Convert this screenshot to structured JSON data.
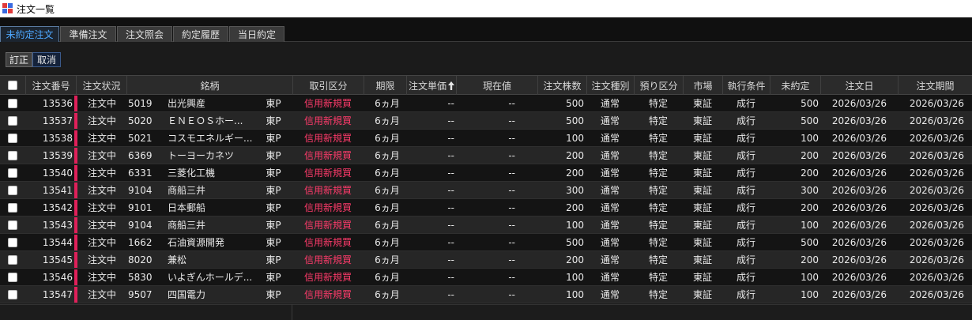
{
  "window": {
    "title": "注文一覧"
  },
  "tabs": [
    {
      "label": "未約定注文",
      "active": true
    },
    {
      "label": "準備注文",
      "active": false
    },
    {
      "label": "注文照会",
      "active": false
    },
    {
      "label": "約定履歴",
      "active": false
    },
    {
      "label": "当日約定",
      "active": false
    }
  ],
  "toolbar": {
    "edit_label": "訂正",
    "cancel_label": "取消"
  },
  "colors": {
    "accent": "#4ea8ff",
    "status_bar": "#e0205a",
    "trade_type": "#ff3b6b"
  },
  "table": {
    "headers": {
      "order_no": "注文番号",
      "status": "注文状況",
      "issue": "銘柄",
      "trade_type": "取引区分",
      "term": "期限",
      "unit_price": "注文単価",
      "unit_price_sort_icon": "sort-up-arrow-icon",
      "current_price": "現在値",
      "qty": "注文株数",
      "order_kind": "注文種別",
      "account": "預り区分",
      "market": "市場",
      "exec_cond": "執行条件",
      "unfilled": "未約定",
      "order_date": "注文日",
      "expiry": "注文期間"
    },
    "rows": [
      {
        "order_no": "13536",
        "status": "注文中",
        "code": "5019",
        "name": "出光興産",
        "exch": "東P",
        "trade_type": "信用新規買",
        "term": "6ヵ月",
        "unit_price": "--",
        "current_price": "--",
        "qty": "500",
        "order_kind": "通常",
        "account": "特定",
        "market": "東証",
        "exec_cond": "成行",
        "unfilled": "500",
        "order_date": "2026/03/26",
        "expiry": "2026/03/26"
      },
      {
        "order_no": "13537",
        "status": "注文中",
        "code": "5020",
        "name": "ＥＮＥＯＳホー...",
        "exch": "東P",
        "trade_type": "信用新規買",
        "term": "6ヵ月",
        "unit_price": "--",
        "current_price": "--",
        "qty": "500",
        "order_kind": "通常",
        "account": "特定",
        "market": "東証",
        "exec_cond": "成行",
        "unfilled": "500",
        "order_date": "2026/03/26",
        "expiry": "2026/03/26"
      },
      {
        "order_no": "13538",
        "status": "注文中",
        "code": "5021",
        "name": "コスモエネルギー...",
        "exch": "東P",
        "trade_type": "信用新規買",
        "term": "6ヵ月",
        "unit_price": "--",
        "current_price": "--",
        "qty": "100",
        "order_kind": "通常",
        "account": "特定",
        "market": "東証",
        "exec_cond": "成行",
        "unfilled": "100",
        "order_date": "2026/03/26",
        "expiry": "2026/03/26"
      },
      {
        "order_no": "13539",
        "status": "注文中",
        "code": "6369",
        "name": "トーヨーカネツ",
        "exch": "東P",
        "trade_type": "信用新規買",
        "term": "6ヵ月",
        "unit_price": "--",
        "current_price": "--",
        "qty": "200",
        "order_kind": "通常",
        "account": "特定",
        "market": "東証",
        "exec_cond": "成行",
        "unfilled": "200",
        "order_date": "2026/03/26",
        "expiry": "2026/03/26"
      },
      {
        "order_no": "13540",
        "status": "注文中",
        "code": "6331",
        "name": "三菱化工機",
        "exch": "東P",
        "trade_type": "信用新規買",
        "term": "6ヵ月",
        "unit_price": "--",
        "current_price": "--",
        "qty": "200",
        "order_kind": "通常",
        "account": "特定",
        "market": "東証",
        "exec_cond": "成行",
        "unfilled": "200",
        "order_date": "2026/03/26",
        "expiry": "2026/03/26"
      },
      {
        "order_no": "13541",
        "status": "注文中",
        "code": "9104",
        "name": "商船三井",
        "exch": "東P",
        "trade_type": "信用新規買",
        "term": "6ヵ月",
        "unit_price": "--",
        "current_price": "--",
        "qty": "300",
        "order_kind": "通常",
        "account": "特定",
        "market": "東証",
        "exec_cond": "成行",
        "unfilled": "300",
        "order_date": "2026/03/26",
        "expiry": "2026/03/26"
      },
      {
        "order_no": "13542",
        "status": "注文中",
        "code": "9101",
        "name": "日本郵船",
        "exch": "東P",
        "trade_type": "信用新規買",
        "term": "6ヵ月",
        "unit_price": "--",
        "current_price": "--",
        "qty": "200",
        "order_kind": "通常",
        "account": "特定",
        "market": "東証",
        "exec_cond": "成行",
        "unfilled": "200",
        "order_date": "2026/03/26",
        "expiry": "2026/03/26"
      },
      {
        "order_no": "13543",
        "status": "注文中",
        "code": "9104",
        "name": "商船三井",
        "exch": "東P",
        "trade_type": "信用新規買",
        "term": "6ヵ月",
        "unit_price": "--",
        "current_price": "--",
        "qty": "100",
        "order_kind": "通常",
        "account": "特定",
        "market": "東証",
        "exec_cond": "成行",
        "unfilled": "100",
        "order_date": "2026/03/26",
        "expiry": "2026/03/26"
      },
      {
        "order_no": "13544",
        "status": "注文中",
        "code": "1662",
        "name": "石油資源開発",
        "exch": "東P",
        "trade_type": "信用新規買",
        "term": "6ヵ月",
        "unit_price": "--",
        "current_price": "--",
        "qty": "500",
        "order_kind": "通常",
        "account": "特定",
        "market": "東証",
        "exec_cond": "成行",
        "unfilled": "500",
        "order_date": "2026/03/26",
        "expiry": "2026/03/26"
      },
      {
        "order_no": "13545",
        "status": "注文中",
        "code": "8020",
        "name": "兼松",
        "exch": "東P",
        "trade_type": "信用新規買",
        "term": "6ヵ月",
        "unit_price": "--",
        "current_price": "--",
        "qty": "200",
        "order_kind": "通常",
        "account": "特定",
        "market": "東証",
        "exec_cond": "成行",
        "unfilled": "200",
        "order_date": "2026/03/26",
        "expiry": "2026/03/26"
      },
      {
        "order_no": "13546",
        "status": "注文中",
        "code": "5830",
        "name": "いよぎんホールデ...",
        "exch": "東P",
        "trade_type": "信用新規買",
        "term": "6ヵ月",
        "unit_price": "--",
        "current_price": "--",
        "qty": "100",
        "order_kind": "通常",
        "account": "特定",
        "market": "東証",
        "exec_cond": "成行",
        "unfilled": "100",
        "order_date": "2026/03/26",
        "expiry": "2026/03/26"
      },
      {
        "order_no": "13547",
        "status": "注文中",
        "code": "9507",
        "name": "四国電力",
        "exch": "東P",
        "trade_type": "信用新規買",
        "term": "6ヵ月",
        "unit_price": "--",
        "current_price": "--",
        "qty": "100",
        "order_kind": "通常",
        "account": "特定",
        "market": "東証",
        "exec_cond": "成行",
        "unfilled": "100",
        "order_date": "2026/03/26",
        "expiry": "2026/03/26"
      }
    ]
  }
}
